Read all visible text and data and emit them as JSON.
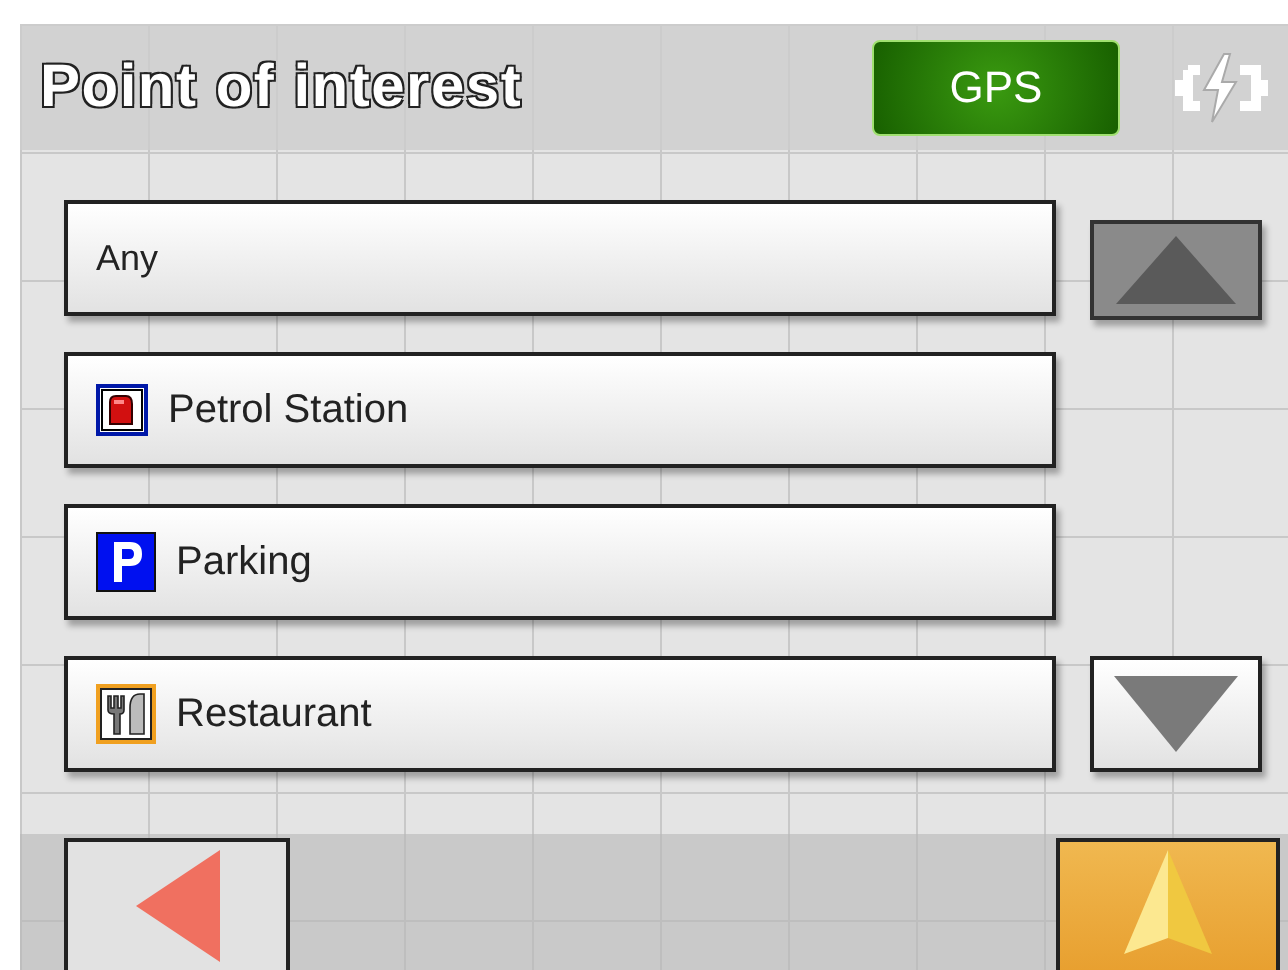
{
  "header": {
    "title": "Point of interest",
    "gps_badge": "GPS"
  },
  "items": [
    {
      "label": "Any",
      "kind": "none"
    },
    {
      "label": "Petrol Station",
      "kind": "petrol"
    },
    {
      "label": "Parking",
      "kind": "parking"
    },
    {
      "label": "Restaurant",
      "kind": "restaurant"
    }
  ]
}
